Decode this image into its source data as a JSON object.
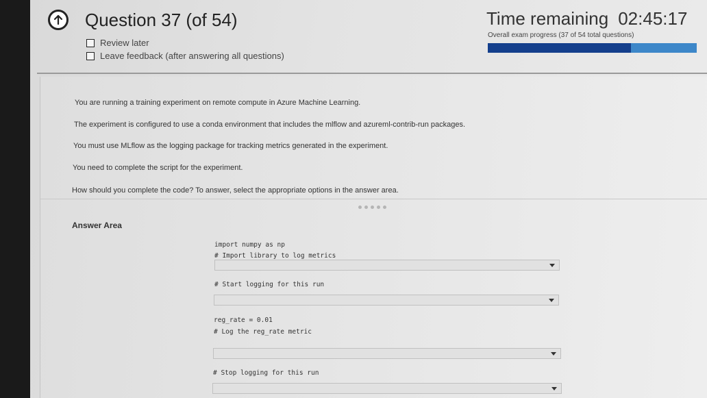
{
  "header": {
    "question_title": "Question 37 (of 54)",
    "review_later": "Review later",
    "leave_feedback": "Leave feedback (after answering all questions)",
    "time_label": "Time remaining",
    "time_value": "02:45:17",
    "progress_label": "Overall exam progress (37 of 54 total questions)",
    "progress_current": 37,
    "progress_total": 54,
    "colors": {
      "progress_fill": "#143f8c",
      "progress_track": "#3d87c9"
    }
  },
  "question": {
    "lines": [
      "You are running a training experiment on remote compute in Azure Machine Learning.",
      "The experiment is configured to use a conda environment that includes the mlflow and azureml-contrib-run packages.",
      "You must use MLflow as the logging package for tracking metrics generated in the experiment.",
      "You need to complete the script for the experiment.",
      "How should you complete the code? To answer, select the appropriate options in the answer area."
    ]
  },
  "answer": {
    "title": "Answer Area",
    "code": [
      "import numpy as np",
      "# Import library to log metrics",
      "# Start logging for this run",
      "reg_rate = 0.01",
      "# Log the reg_rate metric",
      "# Stop logging for this run"
    ]
  },
  "icons": {
    "back": "back-arrow-circle-icon",
    "checkbox": "checkbox-icon",
    "dropdown": "chevron-down-icon"
  }
}
